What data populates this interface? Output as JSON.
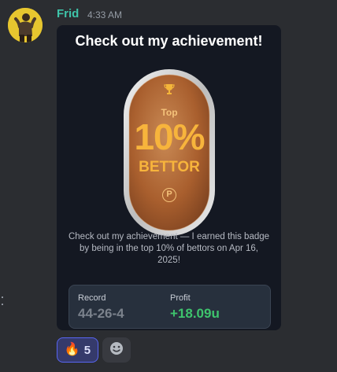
{
  "message": {
    "author": "Frid",
    "timestamp": "4:33 AM"
  },
  "embed": {
    "title": "Check out my achievement!",
    "badge": {
      "top_label": "Top",
      "percent": "10%",
      "subtitle": "BETTOR",
      "icon": "trophy-icon",
      "logo_letter": "P",
      "colors": {
        "bronze": "#b56a35",
        "silver_rim": "#d8d8d8",
        "text": "#f4b53a"
      }
    },
    "description_lines": [
      "Check out my achievement — I earned this badge",
      "by being in the top 10% of bettors on Apr 16,",
      "2025!"
    ],
    "stats": {
      "record_label": "Record",
      "record_value": "44-26-4",
      "profit_label": "Profit",
      "profit_value": "+18.09u"
    }
  },
  "reactions": [
    {
      "emoji": "🔥",
      "icon": "fire-icon",
      "count": "5"
    },
    {
      "icon": "add-reaction-icon"
    }
  ],
  "colors": {
    "background": "#2b2d31",
    "author": "#3ec4a9",
    "profit_positive": "#3ec46d",
    "record": "#7b828c",
    "reaction_active": "#5865f2"
  }
}
